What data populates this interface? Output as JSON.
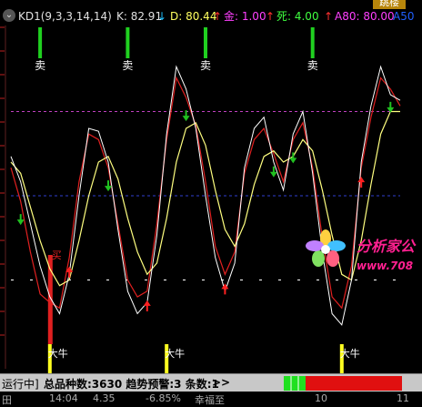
{
  "header": {
    "indicator": "KD1(9,3,3,14,14)",
    "k_label": "K: 82.91",
    "d_label": "D: 80.44",
    "gold_label": "金: 1.00",
    "death_label": "死: 4.00",
    "a80_label": "A80: 80.00",
    "a50_label": "A50",
    "badge": "跳楼"
  },
  "colors": {
    "k_line": "#e02020",
    "d_line": "#ffff80",
    "white_line": "#ffffff",
    "dashed_magenta": "#c040c0",
    "dashed_blue": "#3040d0",
    "sell_bar": "#20d020",
    "buy_bar_red": "#e02020",
    "buy_bar_yellow": "#ffff20",
    "up_arrow": "#ff2020",
    "down_arrow": "#20c020"
  },
  "signals": {
    "sell_text": "卖",
    "bull_text": "大牛",
    "bull_red_text": "买"
  },
  "logo": {
    "text1": "分析家公",
    "text2": "www.708"
  },
  "status_bar": {
    "running": "运行中]",
    "summary": "总品种数:3630 趋势预警:3 条数:1",
    "arrows": ">>"
  },
  "bottom_row": {
    "item1": "田",
    "item2": "14:04",
    "item3": "4.35",
    "item4": "-6.85%",
    "item5": "幸福至",
    "item6": "10",
    "item7": "11"
  },
  "chart_data": {
    "type": "line",
    "series": [
      {
        "name": "K",
        "values": [
          60,
          48,
          30,
          15,
          12,
          10,
          28,
          55,
          72,
          70,
          60,
          40,
          20,
          14,
          16,
          40,
          70,
          92,
          85,
          75,
          55,
          32,
          22,
          30,
          58,
          70,
          74,
          65,
          55,
          70,
          76,
          60,
          35,
          14,
          10,
          25,
          60,
          78,
          92,
          88,
          82
        ]
      },
      {
        "name": "D",
        "values": [
          62,
          58,
          46,
          34,
          24,
          18,
          20,
          34,
          50,
          62,
          64,
          56,
          42,
          30,
          22,
          26,
          42,
          62,
          74,
          76,
          68,
          52,
          38,
          32,
          40,
          54,
          64,
          66,
          62,
          64,
          70,
          66,
          52,
          36,
          22,
          20,
          34,
          54,
          72,
          80,
          80
        ]
      },
      {
        "values": [
          64,
          55,
          40,
          25,
          14,
          8,
          22,
          50,
          74,
          73,
          62,
          38,
          16,
          8,
          12,
          36,
          72,
          96,
          88,
          74,
          50,
          28,
          16,
          26,
          60,
          74,
          78,
          62,
          52,
          72,
          80,
          58,
          30,
          8,
          4,
          20,
          62,
          82,
          96,
          86,
          84
        ]
      }
    ],
    "ylim": [
      -10,
      110
    ],
    "reference_lines": [
      80,
      50,
      20
    ],
    "sell_index": [
      3,
      12,
      20,
      31
    ],
    "bull_index": [
      4,
      16,
      34
    ],
    "gold_cross_index": [
      6,
      14,
      22,
      36
    ],
    "death_cross_index": [
      1,
      10,
      18,
      27,
      29,
      39
    ]
  }
}
